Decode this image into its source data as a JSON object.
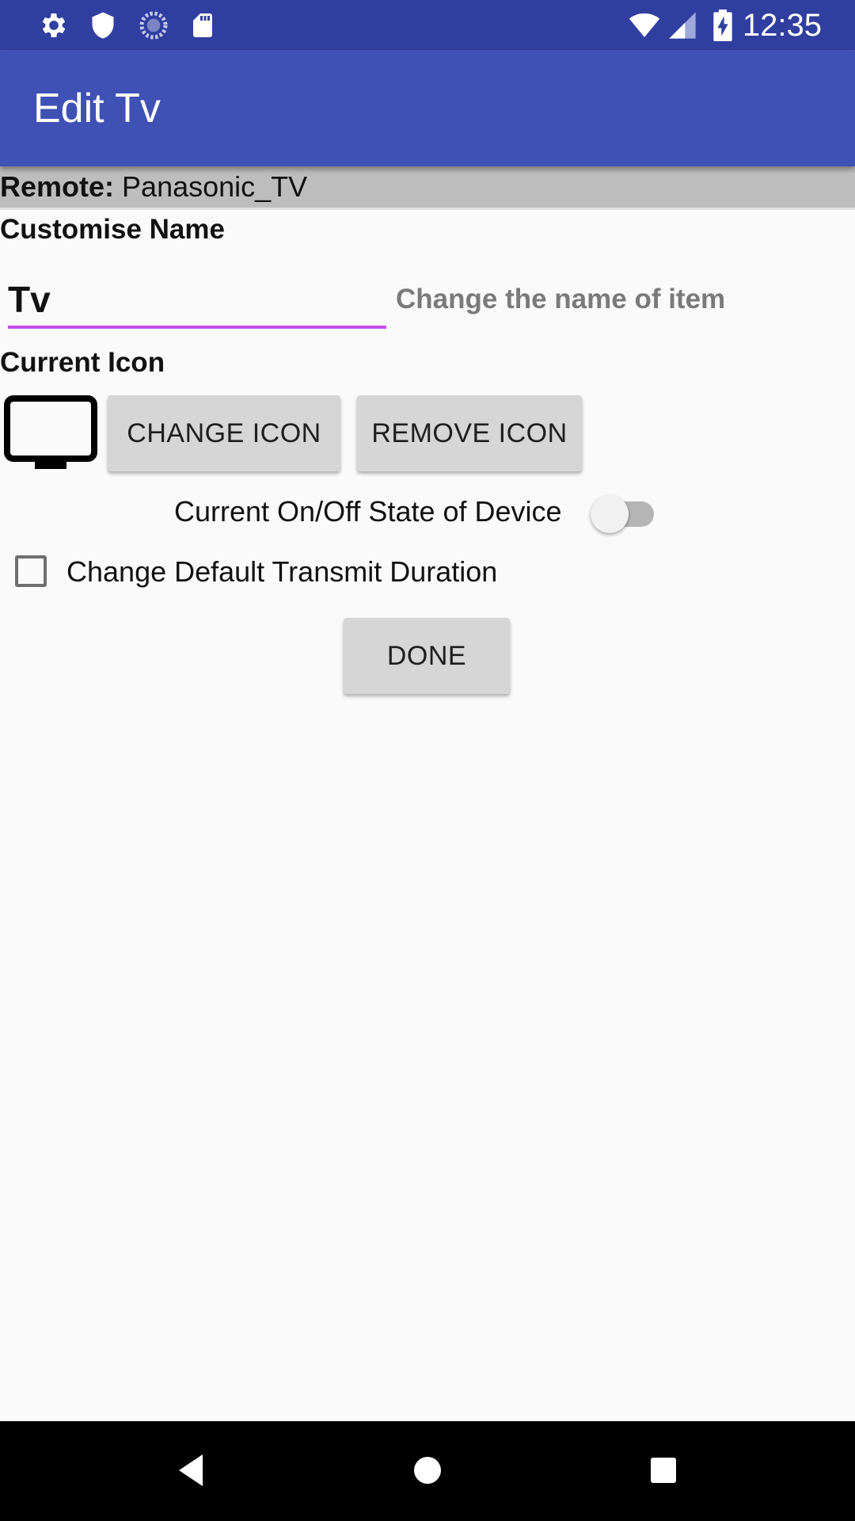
{
  "status_bar": {
    "time": "12:35",
    "icons": [
      "gear-icon",
      "shield-icon",
      "sync-icon",
      "sd-card-icon",
      "wifi-icon",
      "cell-signal-icon",
      "battery-charging-icon"
    ]
  },
  "app_bar": {
    "title": "Edit Tv"
  },
  "remote": {
    "label": "Remote:",
    "value": " Panasonic_TV"
  },
  "customise": {
    "heading": "Customise Name",
    "name_value": "Tv",
    "hint": "Change the name of item"
  },
  "icon_section": {
    "heading": "Current Icon",
    "current_icon": "tv-icon",
    "change_label": "CHANGE ICON",
    "remove_label": "REMOVE ICON"
  },
  "device_state": {
    "label": "Current On/Off State of Device",
    "on": false
  },
  "transmit": {
    "label": "Change Default Transmit Duration",
    "checked": false
  },
  "done_label": "DONE",
  "nav_bar": {
    "icons": [
      "back-icon",
      "home-icon",
      "recents-icon"
    ]
  },
  "colors": {
    "status_bar": "#303f9f",
    "app_bar": "#3f51b5",
    "accent": "#c64dea",
    "button": "#d6d6d6"
  }
}
